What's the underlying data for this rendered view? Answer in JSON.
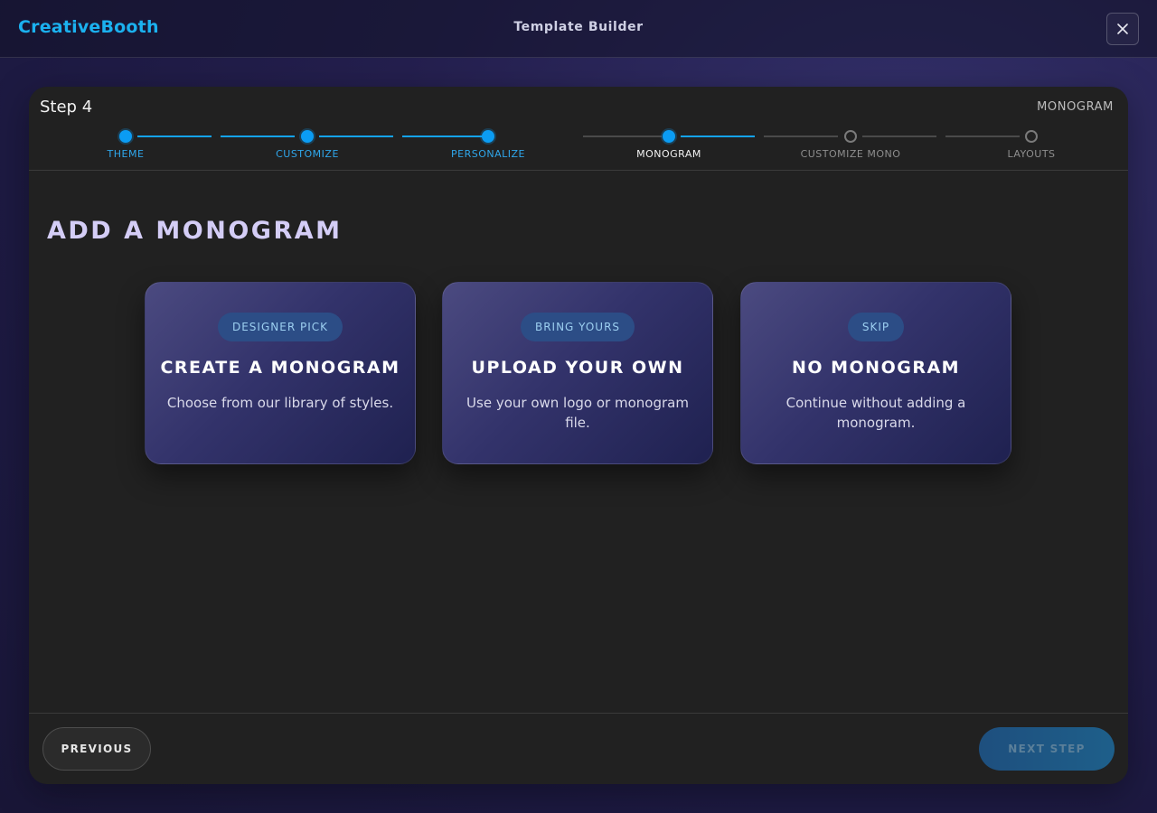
{
  "header": {
    "brand": "CreativeBooth",
    "title": "Template Builder",
    "close_icon": "close-icon"
  },
  "wizard": {
    "step_label": "Step 4",
    "current_step_name": "MONOGRAM",
    "steps": [
      {
        "label": "THEME",
        "status": "done"
      },
      {
        "label": "CUSTOMIZE",
        "status": "done"
      },
      {
        "label": "PERSONALIZE",
        "status": "done"
      },
      {
        "label": "MONOGRAM",
        "status": "current"
      },
      {
        "label": "CUSTOMIZE MONO",
        "status": "todo"
      },
      {
        "label": "LAYOUTS",
        "status": "todo"
      }
    ]
  },
  "main": {
    "heading": "ADD A MONOGRAM",
    "options": [
      {
        "badge": "DESIGNER PICK",
        "title": "CREATE A MONOGRAM",
        "description": "Choose from our library of styles."
      },
      {
        "badge": "BRING YOURS",
        "title": "UPLOAD YOUR OWN",
        "description": "Use your own logo or monogram file."
      },
      {
        "badge": "SKIP",
        "title": "NO MONOGRAM",
        "description": "Continue without adding a monogram."
      }
    ]
  },
  "footer": {
    "previous_label": "PREVIOUS",
    "next_label": "NEXT STEP"
  },
  "colors": {
    "accent": "#14a3f3",
    "brand": "#1bb1ef",
    "heading": "#d4cdf6",
    "modal_bg": "#212121"
  }
}
